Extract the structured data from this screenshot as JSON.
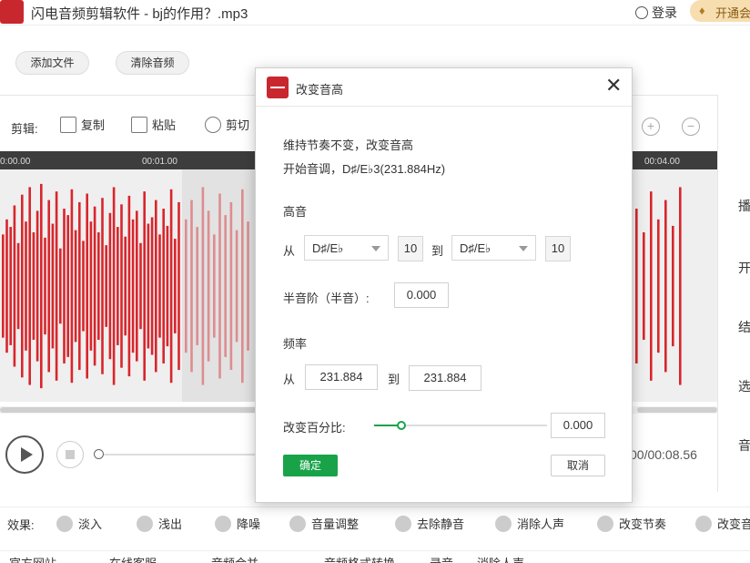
{
  "app": {
    "title": "闪电音频剪辑软件 - bj的作用？.mp3",
    "login": "登录",
    "vip": "开通会",
    "accent": "#c9272e"
  },
  "top": {
    "add_file": "添加文件",
    "clear_audio": "清除音频"
  },
  "edit": {
    "label": "剪辑:",
    "tools": [
      {
        "label": "复制",
        "icon": "copy-icon"
      },
      {
        "label": "粘贴",
        "icon": "paste-icon"
      },
      {
        "label": "剪切",
        "icon": "scissors-icon"
      }
    ]
  },
  "timeline": {
    "ticks": [
      "0:00.00",
      "00:01.00",
      "00:04.00"
    ]
  },
  "waveform": {
    "color": "#d8262c",
    "bars_left": [
      0.48,
      0.62,
      0.55,
      0.75,
      0.4,
      0.85,
      0.6,
      0.92,
      0.5,
      0.7,
      0.95,
      0.45,
      0.8,
      0.58,
      0.88,
      0.35,
      0.72,
      0.66,
      0.9,
      0.52,
      0.78,
      0.42,
      0.86,
      0.6,
      0.74,
      0.5,
      0.82,
      0.38,
      0.68,
      0.92,
      0.55,
      0.76,
      0.46,
      0.84,
      0.62,
      0.7,
      0.4,
      0.88,
      0.58,
      0.64,
      0.8,
      0.48,
      0.72,
      0.56,
      0.9,
      0.44,
      0.78
    ],
    "bars_sel": [
      0.62,
      0.8,
      0.55,
      0.92,
      0.7,
      0.48,
      0.86,
      0.66,
      0.78,
      0.52,
      0.9,
      0.6
    ],
    "bars_right": [
      0.72,
      0.5,
      0.88,
      0.62,
      0.8,
      0.56,
      0.92
    ]
  },
  "playback": {
    "time": "00/00:08.56",
    "progress": 0.0
  },
  "right_panel": [
    "播",
    "开",
    "结",
    "选",
    "音"
  ],
  "effects": {
    "label": "效果:",
    "items": [
      {
        "label": "淡入",
        "icon": "fade-in-icon"
      },
      {
        "label": "浅出",
        "icon": "fade-out-icon"
      },
      {
        "label": "降噪",
        "icon": "denoise-icon"
      },
      {
        "label": "音量调整",
        "icon": "volume-icon"
      },
      {
        "label": "去除静音",
        "icon": "mute-icon"
      },
      {
        "label": "消除人声",
        "icon": "voice-remove-icon"
      },
      {
        "label": "改变节奏",
        "icon": "tempo-icon"
      },
      {
        "label": "改变音",
        "icon": "pitch-icon"
      }
    ]
  },
  "bottom": [
    "官方网站",
    "在线客服",
    "音频合并",
    "音频格式转换",
    "录音",
    "消除人声"
  ],
  "dialog": {
    "title": "改变音高",
    "line1": "维持节奏不变，改变音高",
    "line2": "开始音调，D♯/E♭3(231.884Hz)",
    "pitch_label": "高音",
    "from": "从",
    "to": "到",
    "from_note": "D♯/E♭",
    "from_octave": "10",
    "to_note": "D♯/E♭",
    "to_octave": "10",
    "semitone_label": "半音阶（半音）:",
    "semitone_value": "0.000",
    "freq_label": "频率",
    "freq_from": "231.884",
    "freq_to": "231.884",
    "percent_label": "改变百分比:",
    "percent_value": "0.000",
    "ok": "确定",
    "cancel": "取消",
    "ok_color": "#19a349"
  }
}
